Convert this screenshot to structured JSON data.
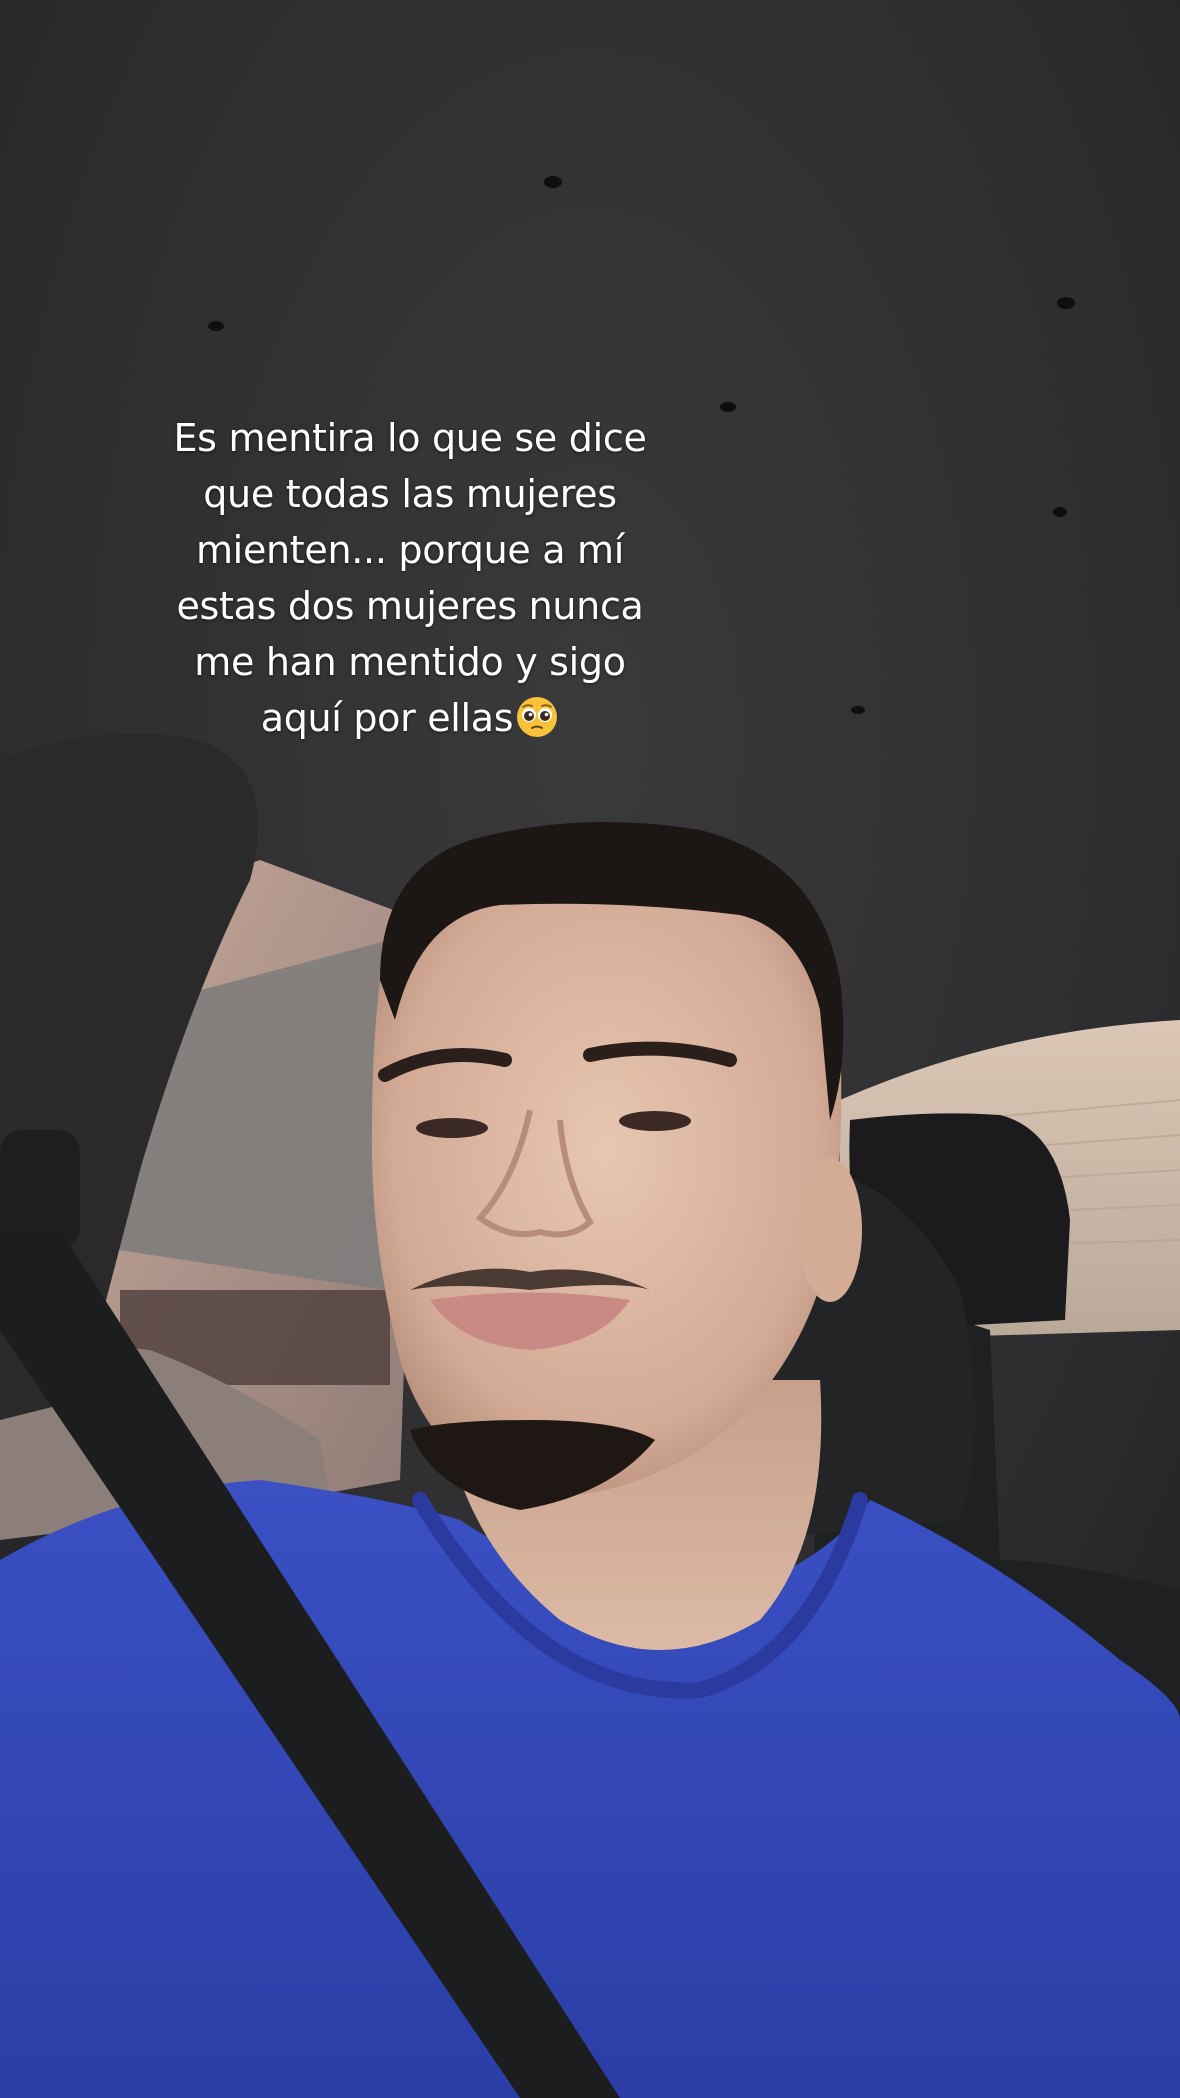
{
  "caption": {
    "lines": [
      "Es mentira lo que se dice",
      "que todas las mujeres",
      "mienten... porque a mí",
      "estas dos mujeres nunca",
      "me han mentido y sigo",
      "aquí por ellas"
    ],
    "emoji": "pleading-face-icon"
  },
  "colors": {
    "headliner": "#2f2f31",
    "shirt": "#3346b8",
    "skin": "#d9b7a3",
    "seatbelt": "#1c1d1f",
    "caption_text": "#ffffff",
    "emoji_face": "#f8c23a"
  }
}
